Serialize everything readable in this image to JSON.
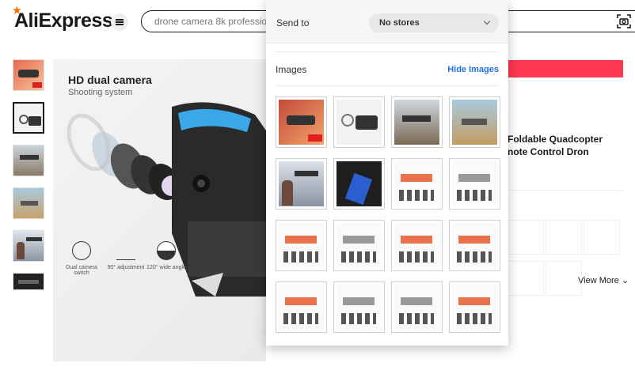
{
  "header": {
    "logo_text": "AliExpress",
    "search_value": "drone camera 8k professiona"
  },
  "main_image": {
    "title": "HD dual camera",
    "subtitle": "Shooting system",
    "features": [
      {
        "label": "Dual camera switch"
      },
      {
        "label": "90° adjustment"
      },
      {
        "label": "120° wide angle"
      }
    ]
  },
  "product": {
    "title_line1": "Foldable Quadcopter",
    "title_line2": "note Control Dron",
    "view_more": "View More"
  },
  "dropdown": {
    "send_to_label": "Send to",
    "store_value": "No stores",
    "images_label": "Images",
    "hide_images_label": "Hide Images"
  },
  "colors": {
    "accent_red": "#fd384f",
    "link_blue": "#1a73e8",
    "logo_star": "#ff6a00"
  }
}
